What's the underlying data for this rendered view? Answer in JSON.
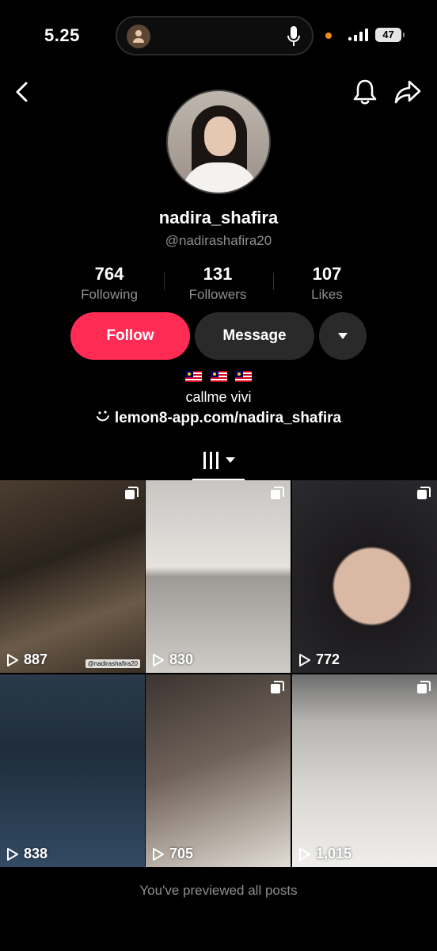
{
  "status_bar": {
    "time": "5.25",
    "battery": "47",
    "recording_dot_color": "#f08a24"
  },
  "nav": {
    "back_icon": "chevron-left-icon",
    "bell_icon": "bell-icon",
    "share_icon": "share-arrow-icon"
  },
  "profile": {
    "display_name": "nadira_shafira",
    "username": "@nadirashafira20",
    "stats": [
      {
        "value": "764",
        "label": "Following"
      },
      {
        "value": "131",
        "label": "Followers"
      },
      {
        "value": "107",
        "label": "Likes"
      }
    ],
    "flags": "🇲🇾 🇲🇾 🇲🇾",
    "bio": "callme vivi",
    "link": "lemon8-app.com/nadira_shafira"
  },
  "actions": {
    "follow_label": "Follow",
    "message_label": "Message",
    "follow_color": "#fe2c55"
  },
  "posts": [
    {
      "views": "887",
      "multi_photo": true,
      "watermark": "@nadirashafira20"
    },
    {
      "views": "830",
      "multi_photo": true
    },
    {
      "views": "772",
      "multi_photo": true
    },
    {
      "views": "838",
      "multi_photo": false
    },
    {
      "views": "705",
      "multi_photo": true
    },
    {
      "views": "1,015",
      "multi_photo": true
    }
  ],
  "footer": {
    "text": "You've previewed all posts"
  }
}
